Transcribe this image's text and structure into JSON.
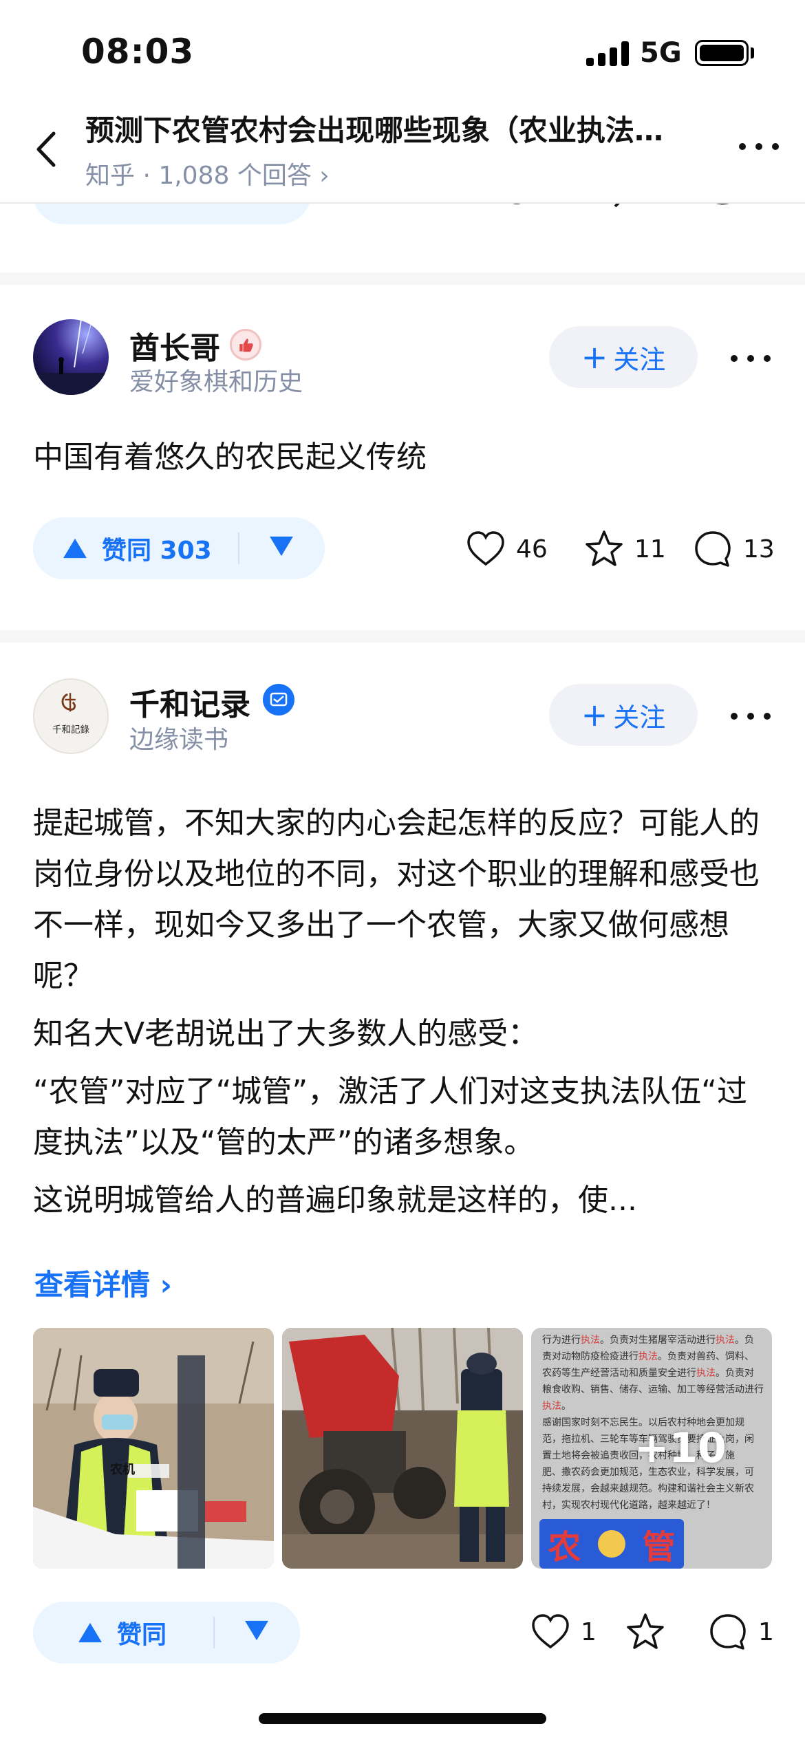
{
  "status_bar": {
    "time": "08:03",
    "network": "5G"
  },
  "nav": {
    "title": "预测下农管农村会出现哪些现象（农业执法）？",
    "subtitle": "知乎 · 1,088 个回答",
    "subtitle_chevron": "›"
  },
  "answers": [
    {
      "author": {
        "name": "酋长哥",
        "bio": "爱好象棋和历史",
        "badge_icon": "thumbs-up-badge-icon"
      },
      "follow_label": "关注",
      "content": [
        "中国有着悠久的农民起义传统"
      ],
      "vote": {
        "label": "赞同 303"
      },
      "likes": "46",
      "favorites": "11",
      "comments": "13"
    },
    {
      "author": {
        "name": "千和记录",
        "bio": "边缘读书",
        "badge_icon": "verified-badge-icon",
        "avatar_text": "千和記錄"
      },
      "follow_label": "关注",
      "content": [
        "提起城管，不知大家的内心会起怎样的反应？可能人的岗位身份以及地位的不同，对这个职业的理解和感受也不一样，现如今又多出了一个农管，大家又做何感想呢？",
        "知名大V老胡说出了大多数人的感受：",
        "“农管”对应了“城管”，激活了人们对这支执法队伍“过度执法”以及“管的太严”的诸多想象。",
        "这说明城管给人的普遍印象就是这样的，使..."
      ],
      "see_more": "查看详情 ›",
      "images": {
        "vest_text": "农机",
        "extra_count": "+10",
        "doc_lines": [
          [
            "行为进行",
            "执法",
            "。负责对生猪屠宰活动进行",
            "执法",
            "。负"
          ],
          [
            "责对动物防疫检疫进行",
            "执法",
            "。负责对兽药、饲料、"
          ],
          [
            "农药等生产经营活动和质量安全进行",
            "执法",
            "。负责对"
          ],
          [
            "粮食收购、销售、储存、运输、加工等经营活动进行"
          ],
          [
            "",
            "执法",
            "。"
          ],
          [
            "感谢国家时刻不忘民生。以后农村种地会更加规"
          ],
          [
            "范，拖拉机、三轮车等车辆驾驶员要持证上岗，闲"
          ],
          [
            "置土地将会被追责收回，农村种地、种子、施"
          ],
          [
            "肥、撒农药会更加规范，生态农业，科学发展，可"
          ],
          [
            "持续发展，会越来越规范。构建和谐社会主义新农"
          ],
          [
            "村，实现农村现代化道路，越来越近了！"
          ]
        ],
        "sign_left": "农",
        "sign_right": "管"
      },
      "vote": {
        "label": "赞同"
      },
      "likes": "1",
      "comments": "1"
    }
  ],
  "colors": {
    "accent": "#1772f6",
    "vote_bg": "#ebf5ff",
    "muted": "#8590a6",
    "separator": "#f6f6f6"
  }
}
